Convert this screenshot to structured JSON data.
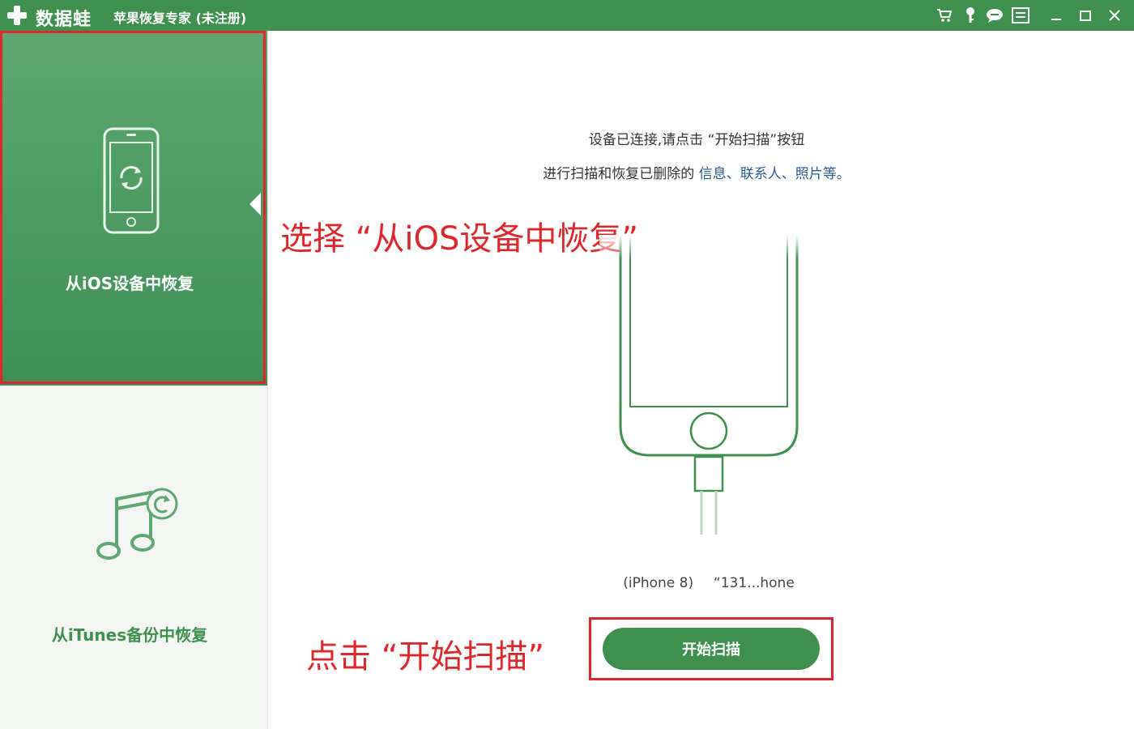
{
  "titlebar": {
    "brand": "数据蛙",
    "app_title": "苹果恢复专家 (未注册)",
    "icons": [
      "cart-icon",
      "key-icon",
      "chat-icon",
      "menu-icon",
      "minimize-icon",
      "maximize-icon",
      "close-icon"
    ]
  },
  "sidebar": {
    "items": [
      {
        "label": "从iOS设备中恢复",
        "icon": "phone-refresh-icon",
        "selected": true
      },
      {
        "label": "从iTunes备份中恢复",
        "icon": "music-note-icon",
        "selected": false
      }
    ]
  },
  "main": {
    "instruction_line1": "设备已连接,请点击 “开始扫描”按钮",
    "instruction_line2_prefix": "进行扫描和恢复已删除的",
    "instruction_line2_highlight": "信息、联系人、照片等。",
    "device_model": "(iPhone 8)",
    "device_name": "“131...hone",
    "scan_button_label": "开始扫描"
  },
  "annotations": {
    "select_hint": "选择 “从iOS设备中恢复”",
    "click_hint": "点击 “开始扫描”"
  },
  "colors": {
    "brand_green": "#3f8f4f",
    "sidebar_selected": "#4c9a62",
    "annotation_red": "#e0262d",
    "highlight_blue": "#2a5a9a"
  }
}
